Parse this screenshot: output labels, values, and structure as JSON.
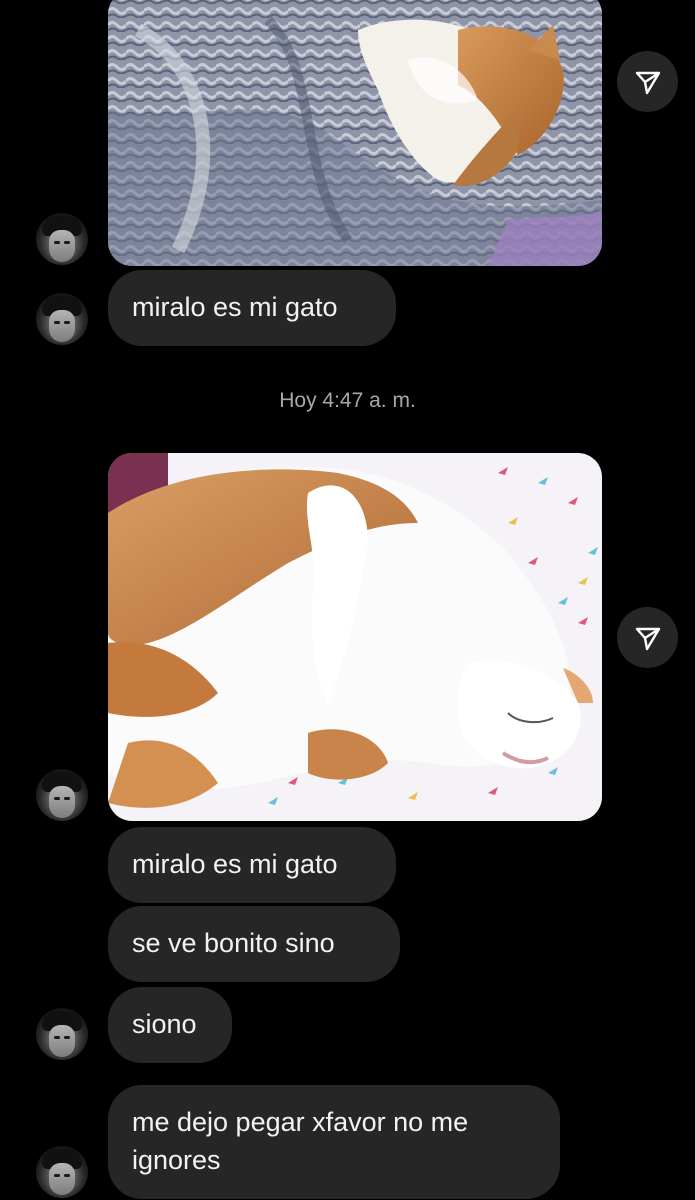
{
  "conversation": {
    "timestamp": "Hoy 4:47 a. m.",
    "messages": [
      {
        "type": "image",
        "description_icon": "cat-photo-blanket"
      },
      {
        "type": "text",
        "text": "miralo es mi gato"
      },
      {
        "type": "image",
        "description_icon": "cat-photo-bed"
      },
      {
        "type": "text",
        "text": "miralo es mi gato"
      },
      {
        "type": "text",
        "text": "se ve bonito sino"
      },
      {
        "type": "text",
        "text": "siono"
      },
      {
        "type": "text",
        "text": "me dejo pegar xfavor no me ignores"
      }
    ]
  },
  "icons": {
    "share": "paper-plane-icon",
    "avatar": "user-avatar"
  },
  "colors": {
    "background": "#000000",
    "bubble": "#262626",
    "text": "#f2f2f2",
    "timestamp": "#a8a8a8"
  }
}
